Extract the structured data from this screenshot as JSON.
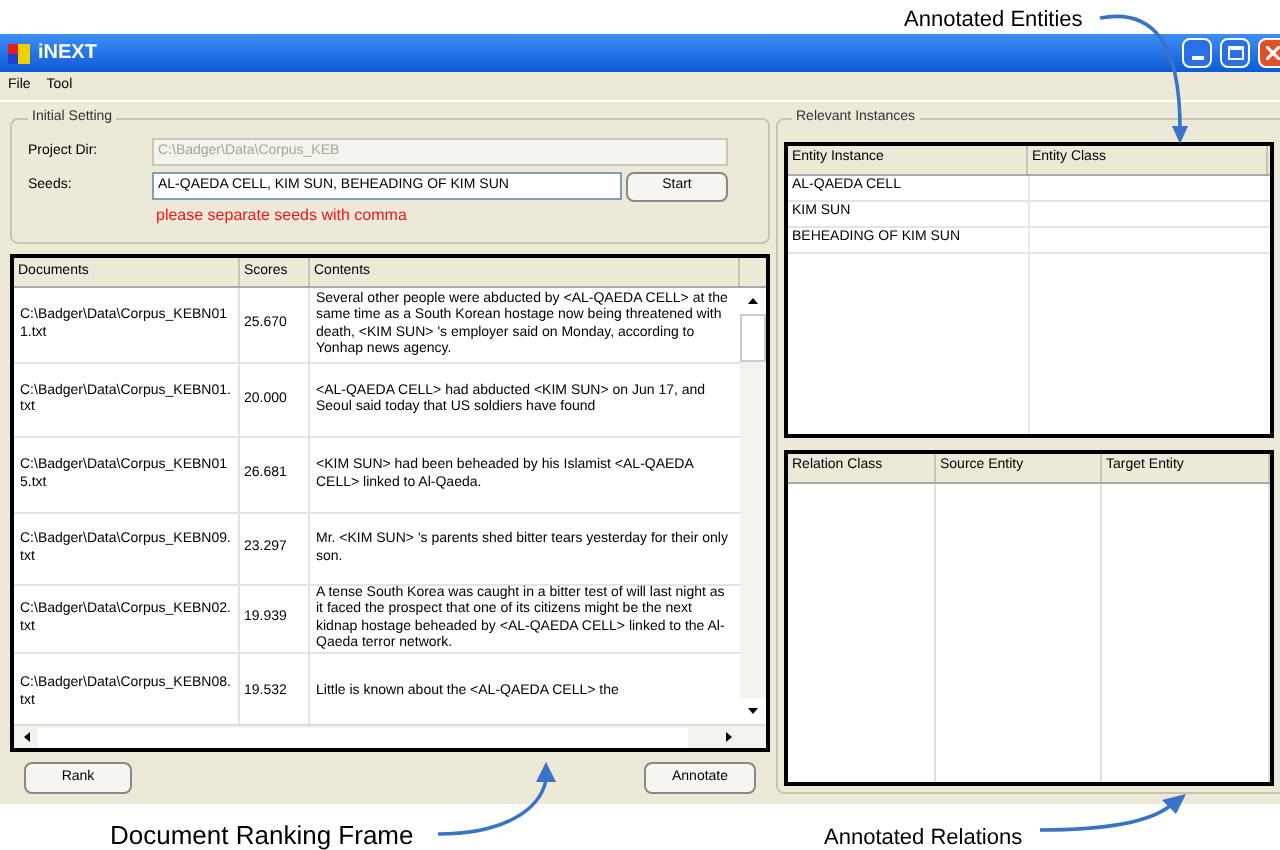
{
  "window": {
    "title": "iNEXT",
    "menu": [
      "File",
      "Tool"
    ]
  },
  "initial_setting": {
    "title": "Initial Setting",
    "project_dir": {
      "label": "Project Dir:",
      "value": "C:\\Badger\\Data\\Corpus_KEB",
      "disabled": true
    },
    "seeds": {
      "label": "Seeds:",
      "value": "AL-QAEDA CELL, KIM SUN, BEHEADING OF KIM SUN",
      "disabled": false
    },
    "start_button": "Start",
    "hint": "please separate seeds with comma"
  },
  "documents": {
    "columns": [
      "Documents",
      "Scores",
      "Contents"
    ],
    "rows": [
      {
        "document": "C:\\Badger\\Data\\Corpus_KEBN011.txt",
        "score": "25.670",
        "contents": "Several other people were abducted by <AL-QAEDA CELL> at the same time as a South Korean hostage now being threatened with death, <KIM SUN> 's employer said on Monday, according to Yonhap news agency."
      },
      {
        "document": "C:\\Badger\\Data\\Corpus_KEBN01.txt",
        "score": "20.000",
        "contents": "<AL-QAEDA CELL> had abducted <KIM SUN> on Jun 17, and Seoul said today that US soldiers have found"
      },
      {
        "document": "C:\\Badger\\Data\\Corpus_KEBN015.txt",
        "score": "26.681",
        "contents": "<KIM SUN> had been beheaded by his Islamist <AL-QAEDA CELL> linked to Al-Qaeda."
      },
      {
        "document": "C:\\Badger\\Data\\Corpus_KEBN09.txt",
        "score": "23.297",
        "contents": "Mr. <KIM SUN> 's parents shed bitter tears yesterday for their only son."
      },
      {
        "document": "C:\\Badger\\Data\\Corpus_KEBN02.txt",
        "score": "19.939",
        "contents": "A tense South Korea was caught in a bitter test of will last night as it faced the prospect that one of its citizens might be the next kidnap hostage beheaded by <AL-QAEDA CELL> linked to the Al-Qaeda terror network."
      },
      {
        "document": "C:\\Badger\\Data\\Corpus_KEBN08.txt",
        "score": "19.532",
        "contents": "Little is known about the <AL-QAEDA CELL> the"
      }
    ]
  },
  "buttons": {
    "rank": "Rank",
    "annotate": "Annotate"
  },
  "relevant_instances": {
    "title": "Relevant Instances",
    "entities": {
      "columns": [
        "Entity Instance",
        "Entity Class"
      ],
      "rows": [
        {
          "entity_instance": "AL-QAEDA CELL"
        },
        {
          "entity_instance": "KIM SUN"
        },
        {
          "entity_instance": "BEHEADING OF KIM SUN"
        }
      ]
    },
    "relations": {
      "columns": [
        "Relation Class",
        "Source Entity",
        "Target Entity"
      ]
    }
  },
  "annotations": [
    {
      "text": "Annotated Entities"
    },
    {
      "text": "Document Ranking Frame"
    },
    {
      "text": "Annotated Relations"
    }
  ]
}
